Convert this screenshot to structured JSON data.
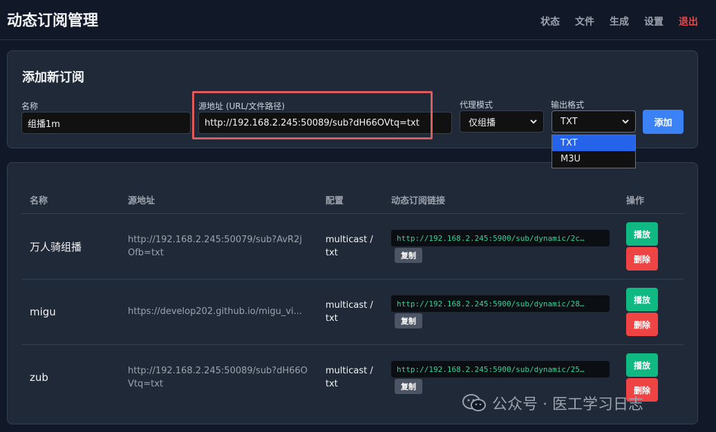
{
  "header": {
    "title": "动态订阅管理",
    "nav": [
      "状态",
      "文件",
      "生成",
      "设置",
      "退出"
    ]
  },
  "add_form": {
    "title": "添加新订阅",
    "name_label": "名称",
    "name_value": "组播1m",
    "source_label": "源地址 (URL/文件路径)",
    "source_value": "http://192.168.2.245:50089/sub?dH66OVtq=txt",
    "proxy_label": "代理模式",
    "proxy_value": "仅组播",
    "format_label": "输出格式",
    "format_value": "TXT",
    "format_options": [
      "TXT",
      "M3U"
    ],
    "add_button": "添加"
  },
  "table": {
    "headers": [
      "名称",
      "源地址",
      "配置",
      "动态订阅链接",
      "操作"
    ],
    "copy_label": "复制",
    "play_label": "播放",
    "delete_label": "删除",
    "rows": [
      {
        "name": "万人骑组播",
        "source": "http://192.168.2.245:50079/sub?AvR2jOfb=txt",
        "config": "multicast / txt",
        "link": "http://192.168.2.245:5900/sub/dynamic/2c…"
      },
      {
        "name": "migu",
        "source": "https://develop202.github.io/migu_vi...",
        "config": "multicast / txt",
        "link": "http://192.168.2.245:5900/sub/dynamic/28…"
      },
      {
        "name": "zub",
        "source": "http://192.168.2.245:50089/sub?dH66OVtq=txt",
        "config": "multicast / txt",
        "link": "http://192.168.2.245:5900/sub/dynamic/25…"
      }
    ]
  },
  "watermark": "公众号 · 医工学习日志",
  "colors": {
    "accent": "#3b82f6",
    "play": "#10b981",
    "delete": "#ef4444",
    "link_text": "#34d399",
    "highlight": "#e05c5c"
  }
}
